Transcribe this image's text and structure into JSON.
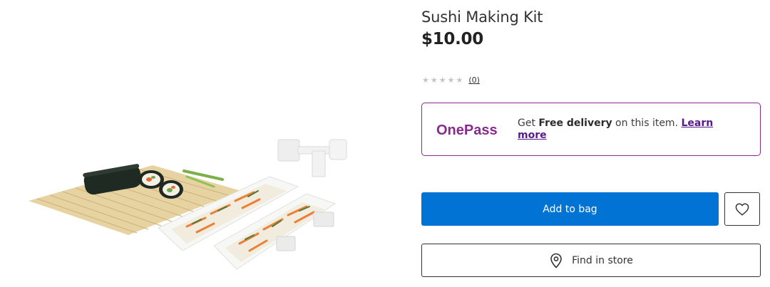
{
  "product": {
    "title": "Sushi Making Kit",
    "price": "$10.00",
    "image_icon": "sushi-kit-product-image"
  },
  "rating": {
    "stars_filled": 0,
    "stars_total": 5,
    "count_label": "(0)"
  },
  "onepass": {
    "logo_text": "OnePass",
    "text_prefix": "Get ",
    "text_bold": "Free delivery",
    "text_suffix": " on this item. ",
    "link_label": "Learn more",
    "brand_color": "#8a2a8e"
  },
  "actions": {
    "add_to_bag_label": "Add to bag",
    "add_to_bag_color": "#0073d4",
    "wishlist_icon": "heart-icon",
    "find_in_store_label": "Find in store",
    "find_in_store_icon": "location-pin-icon"
  }
}
